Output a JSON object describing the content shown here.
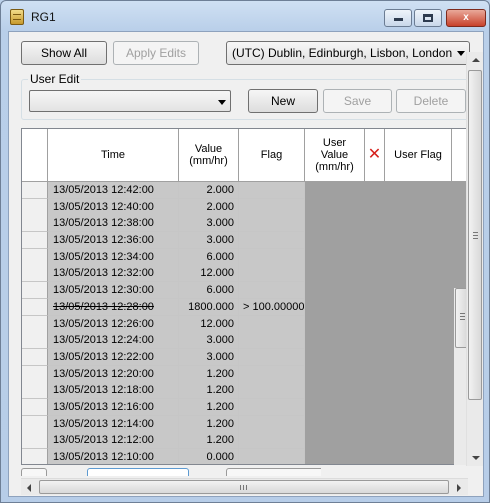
{
  "window": {
    "title": "RG1",
    "minimize_label": "",
    "maximize_label": "",
    "close_label": "x"
  },
  "toolbar": {
    "show_all_label": "Show All",
    "apply_edits_label": "Apply Edits",
    "timezone_selected": "(UTC) Dublin, Edinburgh, Lisbon, London"
  },
  "user_edit": {
    "group_label": "User Edit",
    "selected_value": "",
    "new_label": "New",
    "save_label": "Save",
    "delete_label": "Delete"
  },
  "grid": {
    "headers": {
      "time": "Time",
      "value_line1": "Value",
      "value_line2": "(mm/hr)",
      "flag": "Flag",
      "user_value_line1": "User",
      "user_value_line2": "Value",
      "user_value_line3": "(mm/hr)",
      "user_flag": "User Flag"
    },
    "rows": [
      {
        "time": "13/05/2013 12:42:00",
        "value": "2.000",
        "flag": "",
        "struck": false
      },
      {
        "time": "13/05/2013 12:40:00",
        "value": "2.000",
        "flag": "",
        "struck": false
      },
      {
        "time": "13/05/2013 12:38:00",
        "value": "3.000",
        "flag": "",
        "struck": false
      },
      {
        "time": "13/05/2013 12:36:00",
        "value": "3.000",
        "flag": "",
        "struck": false
      },
      {
        "time": "13/05/2013 12:34:00",
        "value": "6.000",
        "flag": "",
        "struck": false
      },
      {
        "time": "13/05/2013 12:32:00",
        "value": "12.000",
        "flag": "",
        "struck": false
      },
      {
        "time": "13/05/2013 12:30:00",
        "value": "6.000",
        "flag": "",
        "struck": false
      },
      {
        "time": "13/05/2013 12:28:00",
        "value": "1800.000",
        "flag": "> 100.00000",
        "struck": true
      },
      {
        "time": "13/05/2013 12:26:00",
        "value": "12.000",
        "flag": "",
        "struck": false
      },
      {
        "time": "13/05/2013 12:24:00",
        "value": "3.000",
        "flag": "",
        "struck": false
      },
      {
        "time": "13/05/2013 12:22:00",
        "value": "3.000",
        "flag": "",
        "struck": false
      },
      {
        "time": "13/05/2013 12:20:00",
        "value": "1.200",
        "flag": "",
        "struck": false
      },
      {
        "time": "13/05/2013 12:18:00",
        "value": "1.200",
        "flag": "",
        "struck": false
      },
      {
        "time": "13/05/2013 12:16:00",
        "value": "1.200",
        "flag": "",
        "struck": false
      },
      {
        "time": "13/05/2013 12:14:00",
        "value": "1.200",
        "flag": "",
        "struck": false
      },
      {
        "time": "13/05/2013 12:12:00",
        "value": "1.200",
        "flag": "",
        "struck": false
      },
      {
        "time": "13/05/2013 12:10:00",
        "value": "0.000",
        "flag": "",
        "struck": false
      }
    ]
  },
  "icons": {
    "app": "database-icon",
    "delete_column": "red-x-icon"
  },
  "colors": {
    "delete_x": "#d6201c",
    "grid_background": "#a0a0a0",
    "cell_background": "#c8c8c8"
  }
}
